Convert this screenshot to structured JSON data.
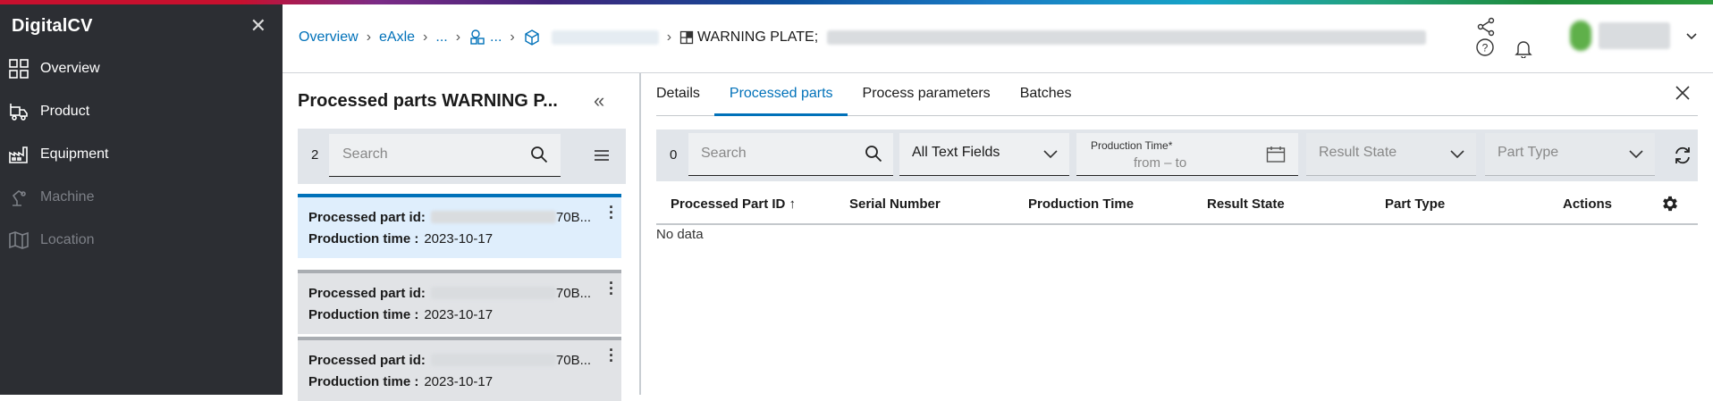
{
  "app": {
    "title": "DigitalCV"
  },
  "sidebar": {
    "items": [
      {
        "label": "Overview",
        "icon": "grid-icon",
        "enabled": true
      },
      {
        "label": "Product",
        "icon": "forklift-icon",
        "enabled": true
      },
      {
        "label": "Equipment",
        "icon": "factory-icon",
        "enabled": true
      },
      {
        "label": "Machine",
        "icon": "robot-arm-icon",
        "enabled": false
      },
      {
        "label": "Location",
        "icon": "map-icon",
        "enabled": false
      }
    ]
  },
  "breadcrumb": {
    "items": [
      {
        "label": "Overview",
        "link": true
      },
      {
        "label": "eAxle",
        "link": true
      },
      {
        "label": "...",
        "link": true
      },
      {
        "label": "...",
        "link": true,
        "icon": "component-icon"
      },
      {
        "label": "",
        "link": true,
        "icon": "cube-icon"
      },
      {
        "label": "WARNING PLATE;",
        "link": false,
        "icon": "plate-icon"
      }
    ]
  },
  "left_panel": {
    "title": "Processed parts WARNING P...",
    "count": "2",
    "search_placeholder": "Search",
    "cards": [
      {
        "id_label": "Processed part id:",
        "id_suffix": "70B...",
        "time_label": "Production time :",
        "time_value": "2023-10-17",
        "selected": true
      },
      {
        "id_label": "Processed part id:",
        "id_suffix": "70B...",
        "time_label": "Production time :",
        "time_value": "2023-10-17",
        "selected": false
      },
      {
        "id_label": "Processed part id:",
        "id_suffix": "70B...",
        "time_label": "Production time :",
        "time_value": "2023-10-17",
        "selected": false
      }
    ]
  },
  "tabs": [
    {
      "label": "Details",
      "active": false
    },
    {
      "label": "Processed parts",
      "active": true
    },
    {
      "label": "Process parameters",
      "active": false
    },
    {
      "label": "Batches",
      "active": false
    }
  ],
  "filters": {
    "count": "0",
    "search_placeholder": "Search",
    "text_field_select": "All Text Fields",
    "production_time_label": "Production Time*",
    "production_time_value": "from – to",
    "result_state_select": "Result State",
    "part_type_select": "Part Type"
  },
  "table": {
    "columns": [
      "Processed Part ID ↑",
      "Serial Number",
      "Production Time",
      "Result State",
      "Part Type",
      "Actions"
    ],
    "empty_text": "No data"
  },
  "colors": {
    "accent": "#0071b9",
    "sidebar_bg": "#2c2e33",
    "selected_card": "#dfeefc"
  }
}
